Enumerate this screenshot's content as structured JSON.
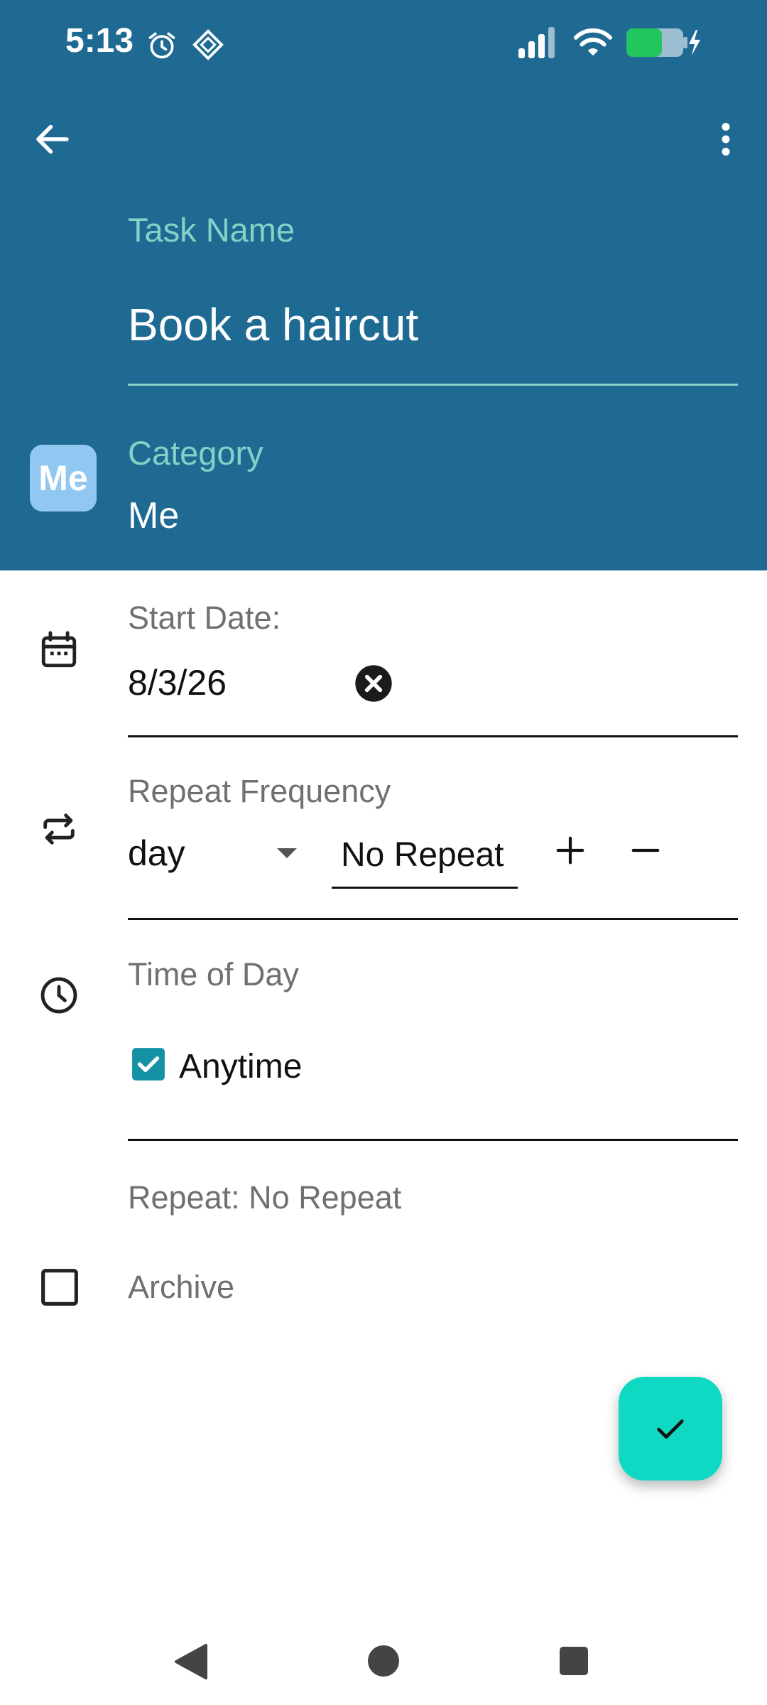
{
  "status_bar": {
    "time": "5:13",
    "icons": [
      "alarm-icon",
      "diamond-app-icon",
      "signal-icon",
      "wifi-icon",
      "battery-charging-icon"
    ]
  },
  "toolbar": {
    "back_icon": "arrow-left-icon",
    "menu_icon": "more-vert-icon"
  },
  "task": {
    "label": "Task Name",
    "value": "Book a haircut"
  },
  "category": {
    "avatar_text": "Me",
    "label": "Category",
    "value": "Me"
  },
  "start_date": {
    "icon": "calendar-icon",
    "label": "Start Date:",
    "value": "8/3/26",
    "clear_icon": "clear-circle-icon"
  },
  "repeat_frequency": {
    "icon": "repeat-icon",
    "label": "Repeat Frequency",
    "unit_selected": "day",
    "count_value": "No Repeat",
    "increment_icon": "plus-icon",
    "decrement_icon": "minus-icon"
  },
  "time_of_day": {
    "icon": "clock-icon",
    "label": "Time of Day",
    "anytime_label": "Anytime",
    "anytime_checked": true
  },
  "repeat_summary": "Repeat: No Repeat",
  "archive": {
    "label": "Archive",
    "checked": false
  },
  "fab_icon": "check-icon",
  "nav": {
    "icons": [
      "back-triangle-icon",
      "home-circle-icon",
      "recents-square-icon"
    ]
  },
  "colors": {
    "header": "#1e6a93",
    "accent_label": "#86d1c6",
    "fab": "#10d9c3",
    "checkbox": "#1591a6",
    "avatar": "#90c8f2"
  }
}
